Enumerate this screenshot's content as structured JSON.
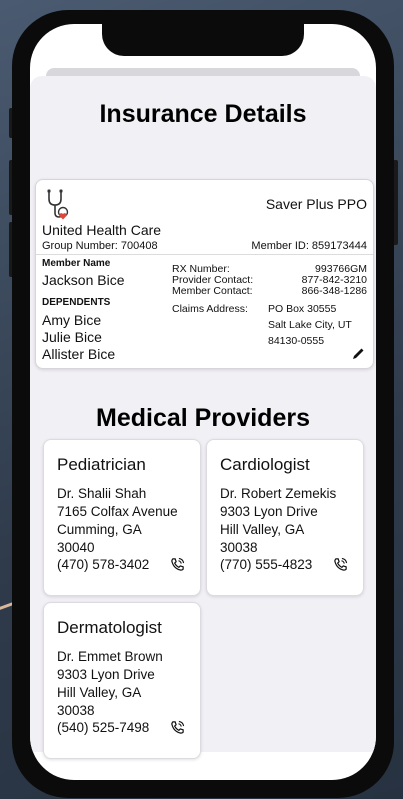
{
  "insurance": {
    "title": "Insurance Details",
    "plan_name": "Saver Plus PPO",
    "carrier": "United Health Care",
    "group_number": "Group Number: 700408",
    "member_id": "Member ID: 859173444",
    "member_name_label": "Member Name",
    "member_name": "Jackson Bice",
    "dependents_label": "DEPENDENTS",
    "dependents": [
      "Amy Bice",
      "Julie Bice",
      "Allister Bice"
    ],
    "rx_label": "RX Number:",
    "rx_value": "993766GM",
    "provider_contact_label": "Provider Contact:",
    "provider_contact_value": "877-842-3210",
    "member_contact_label": "Member Contact:",
    "member_contact_value": "866-348-1286",
    "claims_label": "Claims Address:",
    "claims_lines": [
      "PO Box 30555",
      "Salt Lake City, UT",
      "84130-0555"
    ]
  },
  "providers": {
    "title": "Medical Providers",
    "items": [
      {
        "specialty": "Pediatrician",
        "name": "Dr. Shalii Shah",
        "street": "7165 Colfax Avenue",
        "city": "Cumming, GA",
        "zip": "30040",
        "phone": "(470) 578-3402"
      },
      {
        "specialty": "Cardiologist",
        "name": "Dr. Robert Zemekis",
        "street": "9303 Lyon Drive",
        "city": "Hill Valley, GA",
        "zip": "30038",
        "phone": "(770) 555-4823"
      },
      {
        "specialty": "Dermatologist",
        "name": "Dr. Emmet Brown",
        "street": "9303 Lyon Drive",
        "city": "Hill Valley, GA",
        "zip": "30038",
        "phone": "(540) 525-7498"
      }
    ]
  },
  "icons": {
    "logo": "stethoscope-heart-icon",
    "edit": "pencil-icon",
    "call": "phone-call-icon"
  },
  "colors": {
    "heart": "#e0453a",
    "background": "#f1f0f5"
  }
}
